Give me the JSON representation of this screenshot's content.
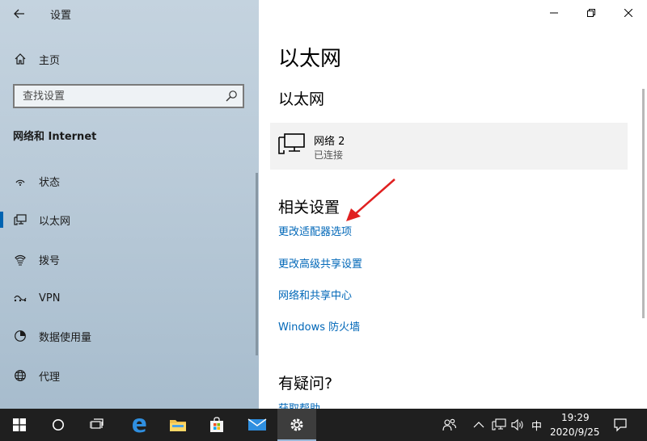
{
  "window": {
    "app_title": "设置"
  },
  "nav": {
    "home_label": "主页",
    "search_placeholder": "查找设置",
    "section_title": "网络和 Internet",
    "items": [
      {
        "label": "状态",
        "icon": "status-icon"
      },
      {
        "label": "以太网",
        "icon": "ethernet-icon",
        "selected": true
      },
      {
        "label": "拨号",
        "icon": "dialup-icon"
      },
      {
        "label": "VPN",
        "icon": "vpn-icon"
      },
      {
        "label": "数据使用量",
        "icon": "data-usage-icon"
      },
      {
        "label": "代理",
        "icon": "proxy-icon"
      }
    ]
  },
  "content": {
    "page_title": "以太网",
    "sub_title": "以太网",
    "network": {
      "name": "网络 2",
      "status": "已连接"
    },
    "related_title": "相关设置",
    "links": [
      "更改适配器选项",
      "更改高级共享设置",
      "网络和共享中心",
      "Windows 防火墙"
    ],
    "help_title": "有疑问?",
    "help_link": "获取帮助"
  },
  "taskbar": {
    "ime": "中",
    "time": "19:29",
    "date": "2020/9/25"
  },
  "colors": {
    "accent": "#0063b1",
    "link": "#0067b8",
    "arrow": "#e02020",
    "taskbar": "#1f1f1f"
  }
}
